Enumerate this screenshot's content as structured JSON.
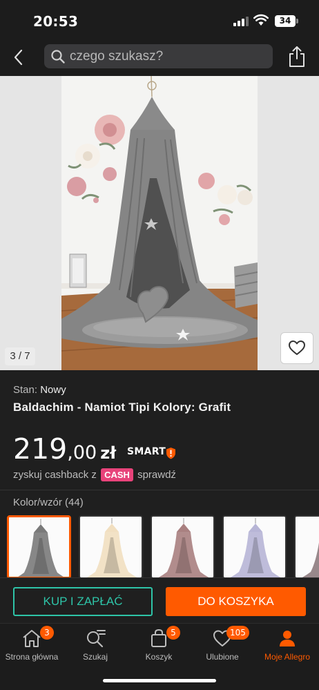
{
  "status_bar": {
    "time": "20:53",
    "battery": "34"
  },
  "header": {
    "search_placeholder": "czego szukasz?"
  },
  "gallery": {
    "counter": "3 / 7"
  },
  "product": {
    "condition_label": "Stan:",
    "condition_value": "Nowy",
    "title": "Baldachim - Namiot Tipi Kolory: Grafit",
    "price_integer": "219",
    "price_decimal": ",00",
    "price_currency": "zł",
    "smart_label": "SMART",
    "cashback_prefix": "zyskuj cashback z",
    "cashback_badge": "CASH",
    "cashback_suffix": "sprawdź",
    "variant_label": "Kolor/wzór (44)",
    "variants": [
      {
        "color": "grafit",
        "hex": "#7a7a7a",
        "selected": true
      },
      {
        "color": "cream",
        "hex": "#f1dfc0",
        "selected": false
      },
      {
        "color": "dusty-rose",
        "hex": "#a98080",
        "selected": false
      },
      {
        "color": "lavender",
        "hex": "#b7b5d6",
        "selected": false
      },
      {
        "color": "mauve",
        "hex": "#8d7b7e",
        "selected": false
      }
    ]
  },
  "actions": {
    "buy_now": "KUP I ZAPŁAĆ",
    "add_to_cart": "DO KOSZYKA"
  },
  "tabbar": {
    "items": [
      {
        "label": "Strona główna",
        "badge": "3",
        "icon": "home-icon"
      },
      {
        "label": "Szukaj",
        "badge": "",
        "icon": "search-list-icon"
      },
      {
        "label": "Koszyk",
        "badge": "5",
        "icon": "shopping-bag-icon"
      },
      {
        "label": "Ulubione",
        "badge": "105",
        "icon": "heart-icon"
      },
      {
        "label": "Moje Allegro",
        "badge": "",
        "icon": "user-icon"
      }
    ]
  },
  "colors": {
    "accent": "#ff5a00",
    "buy_outline": "#2ec4a8",
    "cash_badge": "#e8437a",
    "background": "#1f1f1f"
  }
}
